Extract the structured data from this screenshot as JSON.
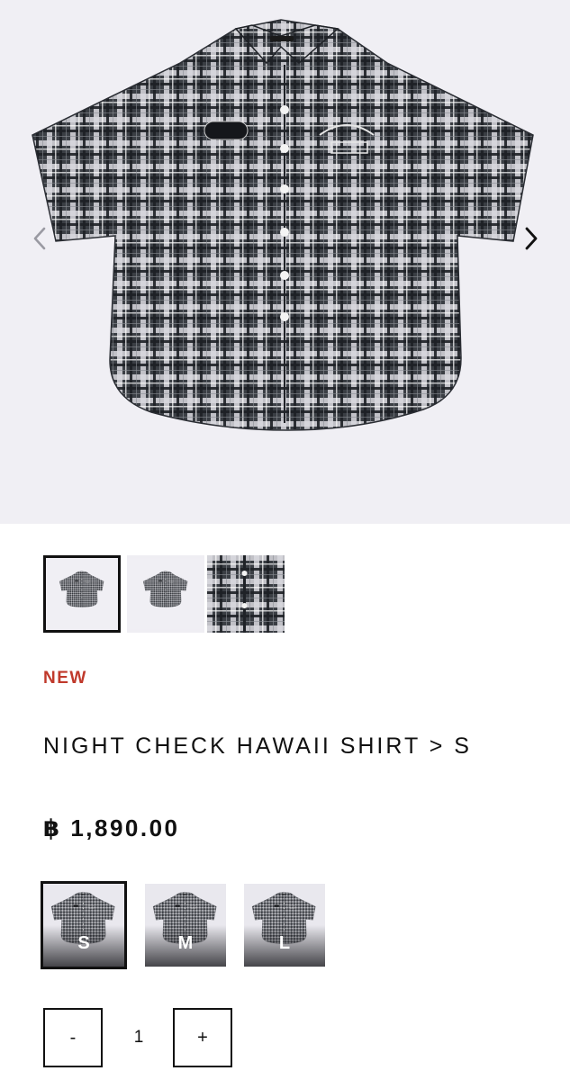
{
  "gallery": {
    "prev_icon": "chevron-left-icon",
    "next_icon": "chevron-right-icon",
    "thumbnails": [
      {
        "name": "thumbnail-front",
        "selected": true
      },
      {
        "name": "thumbnail-back",
        "selected": false
      },
      {
        "name": "thumbnail-detail",
        "selected": false
      }
    ]
  },
  "product": {
    "badge": "NEW",
    "title": "NIGHT CHECK HAWAII SHIRT > S",
    "price": "฿ 1,890.00"
  },
  "variants": [
    {
      "label": "S",
      "selected": true
    },
    {
      "label": "M",
      "selected": false
    },
    {
      "label": "L",
      "selected": false
    }
  ],
  "quantity": {
    "minus_label": "-",
    "value": "1",
    "plus_label": "+"
  },
  "colors": {
    "badge": "#c0392b",
    "text": "#111111",
    "gallery_bg": "#f0eff4",
    "plaid_dark": "#2a2e33",
    "plaid_light": "#e8e8ec"
  }
}
